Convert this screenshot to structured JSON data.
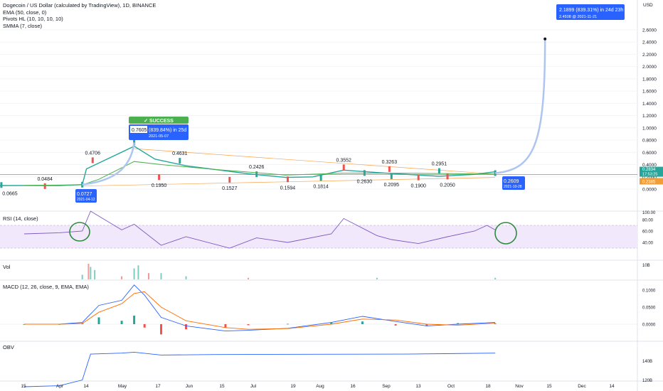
{
  "legend": {
    "title": "Dogecoin / US Dollar (calculated by TradingView), 1D, BINANCE",
    "ema": "EMA (50, close, 0)",
    "pivots": "Pivots HL (10, 10, 10, 10)",
    "smma": "SMMA (7, close)"
  },
  "panes": {
    "rsi": "RSI (14, close)",
    "vol": "Vol",
    "macd": "MACD (12, 26, close, 9, EMA, EMA)",
    "obv": "OBV"
  },
  "price_axis": {
    "unit": "USD",
    "ticks": [
      "2.6000",
      "2.4000",
      "2.2000",
      "2.0000",
      "1.8000",
      "1.6000",
      "1.4000",
      "1.2000",
      "1.0000",
      "0.8000",
      "0.6000",
      "0.4000",
      "0.2000",
      "0.0000"
    ],
    "last_price": "0.2834",
    "countdown": "17:53:25",
    "ema_value": "0.2385"
  },
  "rsi_axis": {
    "ticks": [
      "80.00",
      "60.00",
      "40.00"
    ],
    "top_label": "100.00"
  },
  "vol_axis": {
    "ticks": [
      "10B"
    ]
  },
  "macd_axis": {
    "ticks": [
      "0.1000",
      "0.0500",
      "0.0000"
    ]
  },
  "obv_axis": {
    "ticks": [
      "140B",
      "120B"
    ]
  },
  "time_axis": {
    "labels": [
      "15",
      "Apr",
      "14",
      "May",
      "17",
      "Jun",
      "15",
      "Jul",
      "19",
      "Aug",
      "16",
      "Sep",
      "13",
      "Oct",
      "18",
      "Nov",
      "15",
      "Dec",
      "14"
    ]
  },
  "annotations": {
    "success": "✓ SUCCESS",
    "apr_price": "0.0727",
    "apr_date": "2021-04-12",
    "may_price": "0.7605",
    "may_gain": "(839.84%) in 25d",
    "may_date": "2021-05-07",
    "oct_price": "0.2609",
    "oct_date": "2021-10-28",
    "target_gain": "2.1899 (839.31%) in 24d 23h",
    "target_date": "2.4508 @ 2021-11-21"
  },
  "chart_data": {
    "type": "line",
    "title": "Dogecoin / US Dollar (calculated by TradingView), 1D, BINANCE",
    "ylabel": "USD",
    "ylim": [
      0,
      2.6
    ],
    "x": [
      "2021-03-15",
      "2021-04-01",
      "2021-04-12",
      "2021-04-14",
      "2021-05-07",
      "2021-05-17",
      "2021-06-01",
      "2021-06-15",
      "2021-07-01",
      "2021-07-19",
      "2021-08-01",
      "2021-08-16",
      "2021-09-01",
      "2021-09-13",
      "2021-10-01",
      "2021-10-18",
      "2021-10-28"
    ],
    "series": [
      {
        "name": "Dogecoin / US Dollar",
        "values": [
          0.059,
          0.058,
          0.0727,
          0.33,
          0.7,
          0.49,
          0.38,
          0.32,
          0.25,
          0.19,
          0.2,
          0.31,
          0.27,
          0.245,
          0.21,
          0.24,
          0.2834
        ]
      }
    ],
    "pivot_labels": [
      {
        "date": "2021-03-04",
        "value": 0.0665
      },
      {
        "date": "2021-03-25",
        "value": 0.0484
      },
      {
        "date": "2021-04-12",
        "value": 0.0727
      },
      {
        "date": "2021-04-17",
        "value": 0.4706
      },
      {
        "date": "2021-05-07",
        "value": 0.7605
      },
      {
        "date": "2021-05-19",
        "value": 0.195
      },
      {
        "date": "2021-05-29",
        "value": 0.4631
      },
      {
        "date": "2021-06-22",
        "value": 0.1527
      },
      {
        "date": "2021-07-05",
        "value": 0.2426
      },
      {
        "date": "2021-07-20",
        "value": 0.1594
      },
      {
        "date": "2021-08-05",
        "value": 0.1814
      },
      {
        "date": "2021-08-16",
        "value": 0.3552
      },
      {
        "date": "2021-08-26",
        "value": 0.263
      },
      {
        "date": "2021-09-07",
        "value": 0.3263
      },
      {
        "date": "2021-09-08",
        "value": 0.2095
      },
      {
        "date": "2021-09-21",
        "value": 0.19
      },
      {
        "date": "2021-10-01",
        "value": 0.2951
      },
      {
        "date": "2021-10-05",
        "value": 0.205
      },
      {
        "date": "2021-10-28",
        "value": 0.2609
      }
    ],
    "projection": {
      "from_date": "2021-10-28",
      "from_value": 0.2609,
      "to_date": "2021-11-21",
      "to_value": 2.4508
    },
    "horizontal_level": 0.2385,
    "rsi": {
      "ylim": [
        20,
        100
      ],
      "band": [
        30,
        70
      ],
      "x": [
        "2021-03-15",
        "2021-04-01",
        "2021-04-12",
        "2021-04-16",
        "2021-05-01",
        "2021-05-07",
        "2021-05-20",
        "2021-06-01",
        "2021-06-22",
        "2021-07-05",
        "2021-07-20",
        "2021-08-10",
        "2021-08-16",
        "2021-09-01",
        "2021-09-08",
        "2021-09-21",
        "2021-10-05",
        "2021-10-18",
        "2021-10-24",
        "2021-10-28"
      ],
      "values": [
        55,
        57,
        60,
        95,
        62,
        72,
        35,
        50,
        30,
        48,
        40,
        55,
        82,
        52,
        45,
        38,
        50,
        60,
        70,
        62
      ]
    },
    "volume": {
      "x": [
        "2021-04-12",
        "2021-04-15",
        "2021-04-16",
        "2021-04-18",
        "2021-05-01",
        "2021-05-07",
        "2021-05-09",
        "2021-05-14",
        "2021-05-20",
        "2021-06-01",
        "2021-07-01",
        "2021-09-01",
        "2021-10-28"
      ],
      "values": [
        3,
        10,
        8,
        6,
        2,
        7,
        9,
        4,
        4,
        2,
        1,
        1,
        1
      ],
      "unit": "B"
    },
    "macd": {
      "ylim": [
        -0.03,
        0.12
      ],
      "x": [
        "2021-03-15",
        "2021-04-01",
        "2021-04-12",
        "2021-04-20",
        "2021-05-01",
        "2021-05-07",
        "2021-05-12",
        "2021-05-20",
        "2021-06-01",
        "2021-06-20",
        "2021-07-01",
        "2021-07-20",
        "2021-08-10",
        "2021-08-25",
        "2021-09-10",
        "2021-09-25",
        "2021-10-10",
        "2021-10-28"
      ],
      "macd_line": [
        0.0,
        0.0,
        0.005,
        0.055,
        0.07,
        0.115,
        0.085,
        0.02,
        -0.005,
        -0.02,
        -0.018,
        -0.012,
        0.005,
        0.023,
        0.008,
        -0.005,
        0.0,
        0.005
      ],
      "signal_line": [
        0.0,
        0.0,
        0.002,
        0.035,
        0.06,
        0.09,
        0.095,
        0.05,
        0.01,
        -0.01,
        -0.015,
        -0.013,
        0.0,
        0.015,
        0.012,
        0.0,
        -0.003,
        0.003
      ]
    },
    "obv": {
      "ylim": [
        110,
        155
      ],
      "unit": "B",
      "x": [
        "2021-03-15",
        "2021-04-01",
        "2021-04-12",
        "2021-04-16",
        "2021-05-01",
        "2021-05-07",
        "2021-05-20",
        "2021-06-15",
        "2021-08-01",
        "2021-09-15",
        "2021-10-28"
      ],
      "values": [
        113,
        114,
        120,
        147,
        148,
        149,
        146,
        146.5,
        146.8,
        147,
        148
      ]
    }
  }
}
